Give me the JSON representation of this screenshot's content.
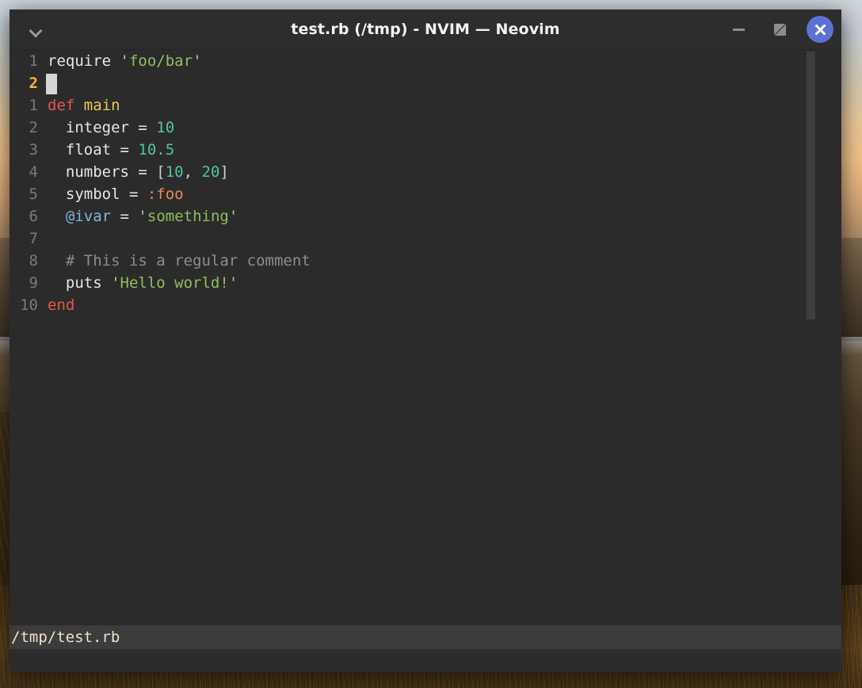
{
  "window": {
    "title": "test.rb (/tmp) - NVIM — Neovim",
    "menu_icon": "chevron-down-icon",
    "controls": {
      "minimize_icon": "minimize-icon",
      "restore_icon": "restore-icon",
      "close_icon": "close-icon",
      "close_bg": "#5b72d4"
    }
  },
  "editor": {
    "colors": {
      "background": "#2b2b2b",
      "foreground": "#e6e6e6",
      "line_number": "#7b7b7b",
      "cursor_line_number": "#ffb536",
      "keyword": "#e8564a",
      "function": "#ecc94b",
      "string": "#8fbf5f",
      "number": "#4fc4a6",
      "symbol": "#e98b55",
      "ivar": "#7db7d8",
      "comment": "#8d8d8d",
      "cursor": "#d6d6d6"
    },
    "buffers": [
      {
        "name": "buffer-top",
        "lines": [
          {
            "number": "1",
            "current": false,
            "tokens": [
              {
                "t": "require",
                "c": "plain"
              },
              {
                "t": " ",
                "c": "plain"
              },
              {
                "t": "'",
                "c": "quote"
              },
              {
                "t": "foo/bar",
                "c": "str"
              },
              {
                "t": "'",
                "c": "quote"
              }
            ]
          },
          {
            "number": "2",
            "current": true,
            "tokens": []
          }
        ]
      },
      {
        "name": "buffer-main",
        "lines": [
          {
            "number": "1",
            "current": false,
            "tokens": [
              {
                "t": "def",
                "c": "kw"
              },
              {
                "t": " ",
                "c": "plain"
              },
              {
                "t": "main",
                "c": "fn"
              }
            ]
          },
          {
            "number": "2",
            "current": false,
            "tokens": [
              {
                "t": "  integer ",
                "c": "plain"
              },
              {
                "t": "= ",
                "c": "plain"
              },
              {
                "t": "10",
                "c": "num"
              }
            ]
          },
          {
            "number": "3",
            "current": false,
            "tokens": [
              {
                "t": "  float ",
                "c": "plain"
              },
              {
                "t": "= ",
                "c": "plain"
              },
              {
                "t": "10.5",
                "c": "num"
              }
            ]
          },
          {
            "number": "4",
            "current": false,
            "tokens": [
              {
                "t": "  numbers ",
                "c": "plain"
              },
              {
                "t": "= ",
                "c": "plain"
              },
              {
                "t": "[",
                "c": "punct"
              },
              {
                "t": "10",
                "c": "num"
              },
              {
                "t": ", ",
                "c": "punct"
              },
              {
                "t": "20",
                "c": "num"
              },
              {
                "t": "]",
                "c": "punct"
              }
            ]
          },
          {
            "number": "5",
            "current": false,
            "tokens": [
              {
                "t": "  symbol ",
                "c": "plain"
              },
              {
                "t": "= ",
                "c": "plain"
              },
              {
                "t": ":foo",
                "c": "sym"
              }
            ]
          },
          {
            "number": "6",
            "current": false,
            "tokens": [
              {
                "t": "  ",
                "c": "plain"
              },
              {
                "t": "@ivar",
                "c": "ivar"
              },
              {
                "t": " = ",
                "c": "plain"
              },
              {
                "t": "'",
                "c": "quote"
              },
              {
                "t": "something",
                "c": "str"
              },
              {
                "t": "'",
                "c": "quote"
              }
            ]
          },
          {
            "number": "7",
            "current": false,
            "tokens": []
          },
          {
            "number": "8",
            "current": false,
            "tokens": [
              {
                "t": "  # This is a regular comment",
                "c": "comment"
              }
            ]
          },
          {
            "number": "9",
            "current": false,
            "tokens": [
              {
                "t": "  puts ",
                "c": "plain"
              },
              {
                "t": "'",
                "c": "quote"
              },
              {
                "t": "Hello world!",
                "c": "str"
              },
              {
                "t": "'",
                "c": "quote"
              }
            ]
          },
          {
            "number": "10",
            "current": false,
            "tokens": [
              {
                "t": "end",
                "c": "kw"
              }
            ]
          }
        ]
      }
    ]
  },
  "statusline": {
    "text": "/tmp/test.rb"
  },
  "cmdline": {
    "text": ""
  }
}
